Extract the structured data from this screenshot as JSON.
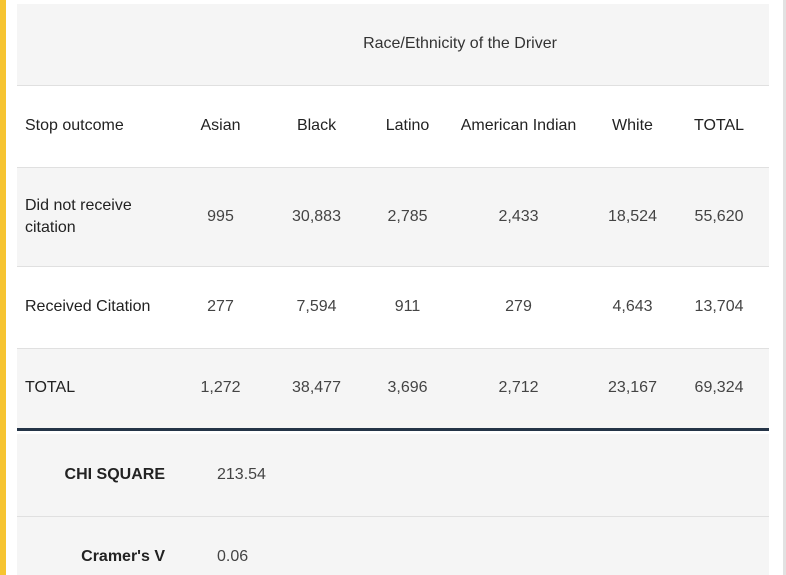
{
  "table": {
    "title": "Race/Ethnicity of the Driver",
    "row_header": "Stop outcome",
    "columns": [
      "Asian",
      "Black",
      "Latino",
      "American Indian",
      "White",
      "TOTAL"
    ],
    "rows": [
      {
        "label": "Did not receive citation",
        "values": [
          "995",
          "30,883",
          "2,785",
          "2,433",
          "18,524",
          "55,620"
        ]
      },
      {
        "label": "Received Citation",
        "values": [
          "277",
          "7,594",
          "911",
          "279",
          "4,643",
          "13,704"
        ]
      },
      {
        "label": "TOTAL",
        "values": [
          "1,272",
          "38,477",
          "3,696",
          "2,712",
          "23,167",
          "69,324"
        ]
      }
    ]
  },
  "stats": {
    "chi_square_label": "CHI SQUARE",
    "chi_square_value": "213.54",
    "cramers_v_label": "Cramer's V",
    "cramers_v_value": "0.06"
  },
  "colors": {
    "accent": "#f6c431",
    "rule": "#243447"
  }
}
